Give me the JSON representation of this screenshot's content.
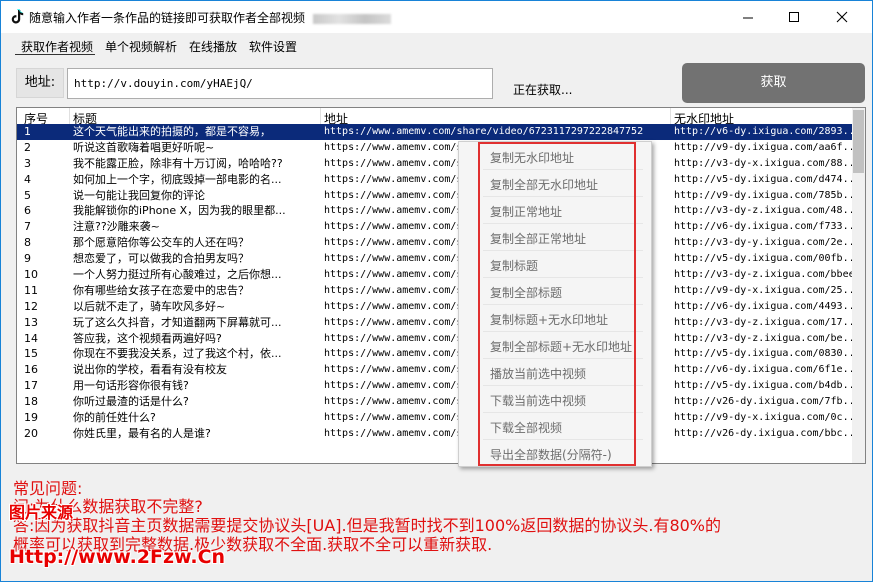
{
  "window": {
    "title": "随意输入作者一条作品的链接即可获取作者全部视频",
    "controls": [
      "minimize",
      "maximize",
      "close"
    ]
  },
  "tabs": [
    "获取作者视频",
    "单个视频解析",
    "在线播放",
    "软件设置"
  ],
  "address": {
    "label": "地址:",
    "value": "http://v.douyin.com/yHAEjQ/"
  },
  "status_text": "正在获取...",
  "fetch_button": "获取",
  "table": {
    "columns": [
      "序号",
      "标题",
      "地址",
      "无水印地址"
    ],
    "rows": [
      {
        "n": "1",
        "title": "这个天气能出来的拍摄的，都是不容易，",
        "url": "https://www.amemv.com/share/video/6723117297222847752",
        "nowm": "http://v6-dy.ixigua.com/2893..."
      },
      {
        "n": "2",
        "title": "听说这首歌嗨着唱更好听呢~",
        "url": "https://www.amemv.com/share",
        "nowm": "http://v9-dy.ixigua.com/aa6f..."
      },
      {
        "n": "3",
        "title": "我不能露正脸，除非有十万订阅，哈哈哈??",
        "url": "https://www.amemv.com/share",
        "nowm": "http://v3-dy-x.ixigua.com/88..."
      },
      {
        "n": "4",
        "title": "如何加上一个字，彻底毁掉一部电影的名...",
        "url": "https://www.amemv.com/share",
        "nowm": "http://v5-dy.ixigua.com/d474..."
      },
      {
        "n": "5",
        "title": "说一句能让我回复你的评论",
        "url": "https://www.amemv.com/share",
        "nowm": "http://v9-dy.ixigua.com/785b..."
      },
      {
        "n": "6",
        "title": "我能解锁你的iPhone X，因为我的眼里都...",
        "url": "https://www.amemv.com/share",
        "nowm": "http://v3-dy-z.ixigua.com/48..."
      },
      {
        "n": "7",
        "title": "注意??沙雕来袭~",
        "url": "https://www.amemv.com/share",
        "nowm": "http://v6-dy.ixigua.com/f733..."
      },
      {
        "n": "8",
        "title": "那个愿意陪你等公交车的人还在吗？",
        "url": "https://www.amemv.com/share",
        "nowm": "http://v3-dy-y.ixigua.com/2e..."
      },
      {
        "n": "9",
        "title": "想恋爱了，可以做我的合拍男友吗？",
        "url": "https://www.amemv.com/share",
        "nowm": "http://v5-dy.ixigua.com/00fb..."
      },
      {
        "n": "10",
        "title": "一个人努力挺过所有心酸难过，之后你想...",
        "url": "https://www.amemv.com/share",
        "nowm": "http://v3-dy-z.ixigua.com/bbee..."
      },
      {
        "n": "11",
        "title": "你有哪些给女孩子在恋爱中的忠告？",
        "url": "https://www.amemv.com/share",
        "nowm": "http://v9-dy-x.ixigua.com/25..."
      },
      {
        "n": "12",
        "title": "以后就不走了，骑车吹风多好~",
        "url": "https://www.amemv.com/share",
        "nowm": "http://v6-dy.ixigua.com/4493..."
      },
      {
        "n": "13",
        "title": "玩了这么久抖音，才知道翻两下屏幕就可...",
        "url": "https://www.amemv.com/share",
        "nowm": "http://v3-dy-z.ixigua.com/17..."
      },
      {
        "n": "14",
        "title": "答应我，这个视频看两遍好吗?",
        "url": "https://www.amemv.com/share",
        "nowm": "http://v3-dy-z.ixigua.com/be..."
      },
      {
        "n": "15",
        "title": "你现在不要我没关系，过了我这个村，依...",
        "url": "https://www.amemv.com/share",
        "nowm": "http://v5-dy.ixigua.com/0830..."
      },
      {
        "n": "16",
        "title": "说出你的学校，看看有没有校友",
        "url": "https://www.amemv.com/share",
        "nowm": "http://v6-dy.ixigua.com/6f1e..."
      },
      {
        "n": "17",
        "title": "用一句话形容你很有钱?",
        "url": "https://www.amemv.com/share",
        "nowm": "http://v5-dy.ixigua.com/b4db..."
      },
      {
        "n": "18",
        "title": "你听过最渣的话是什么?",
        "url": "https://www.amemv.com/share",
        "nowm": "http://v26-dy.ixigua.com/7fb..."
      },
      {
        "n": "19",
        "title": "你的前任姓什么?",
        "url": "https://www.amemv.com/share",
        "nowm": "http://v9-dy-x.ixigua.com/0c..."
      },
      {
        "n": "20",
        "title": "你姓氏里，最有名的人是谁?",
        "url": "https://www.amemv.com/share",
        "nowm": "http://v26-dy.ixigua.com/bbc..."
      }
    ]
  },
  "context_menu": [
    "复制无水印地址",
    "复制全部无水印地址",
    "复制正常地址",
    "复制全部正常地址",
    "复制标题",
    "复制全部标题",
    "复制标题+无水印地址",
    "复制全部标题+无水印地址",
    "播放当前选中视频",
    "下载当前选中视频",
    "下载全部视频",
    "导出全部数据(分隔符-)"
  ],
  "faq": {
    "heading": "常见问题:",
    "q1": "问:为什么数据获取不完整?",
    "a1": "答:因为获取抖音主页数据需要提交协议头[UA].但是我暂时找不到100%返回数据的协议头.有80%的",
    "a1_cont": "概率可以获取到完整数据.极少数获取不全面.获取不全可以重新获取."
  },
  "watermark": {
    "line1": "图片来源",
    "line2": "Http://www.2Fzw.Cn"
  },
  "colors": {
    "accent_border": "#1883d7",
    "selected_row": "#0b2a7a",
    "faq_red": "#e01010",
    "menu_frame": "#e03030",
    "fetch_button_bg": "#727272"
  }
}
